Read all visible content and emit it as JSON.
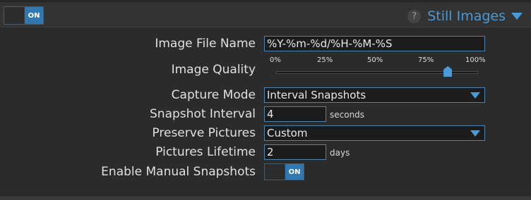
{
  "header": {
    "toggle_label": "ON",
    "help_glyph": "?",
    "title": "Still Images"
  },
  "form": {
    "image_file_name": {
      "label": "Image File Name",
      "value": "%Y-%m-%d/%H-%M-%S"
    },
    "image_quality": {
      "label": "Image Quality",
      "ticks": [
        "0%",
        "25%",
        "50%",
        "75%",
        "100%"
      ],
      "value_percent": 85
    },
    "capture_mode": {
      "label": "Capture Mode",
      "value": "Interval Snapshots"
    },
    "snapshot_interval": {
      "label": "Snapshot Interval",
      "value": "4",
      "unit": "seconds"
    },
    "preserve_pictures": {
      "label": "Preserve Pictures",
      "value": "Custom"
    },
    "pictures_lifetime": {
      "label": "Pictures Lifetime",
      "value": "2",
      "unit": "days"
    },
    "enable_manual_snapshots": {
      "label": "Enable Manual Snapshots",
      "toggle_label": "ON"
    }
  },
  "colors": {
    "accent": "#4a9ad8",
    "toggle_on": "#2f78b2",
    "background": "#2b2b2b"
  }
}
